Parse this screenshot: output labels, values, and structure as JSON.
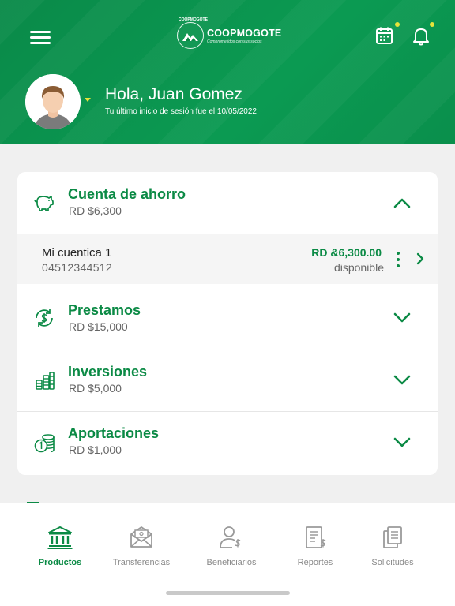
{
  "header": {
    "logo_name": "COOPMOGOTE",
    "logo_arc": "COOPMOGOTE",
    "logo_tagline": "Comprometidos con sus socios",
    "greeting": "Hola, Juan Gomez",
    "last_login": "Tu último inicio de sesión fue el 10/05/2022",
    "colors": {
      "primary": "#0b8a45",
      "notification_dot": "#e6e43a"
    }
  },
  "products": [
    {
      "title": "Cuenta de ahorro",
      "amount": "RD $6,300",
      "icon": "piggy-bank-icon",
      "expanded": true
    },
    {
      "title": "Prestamos",
      "amount": "RD $15,000",
      "icon": "loan-refresh-dollar-icon",
      "expanded": false
    },
    {
      "title": "Inversiones",
      "amount": "RD $5,000",
      "icon": "coins-stack-icon",
      "expanded": false
    },
    {
      "title": "Aportaciones",
      "amount": "RD $1,000",
      "icon": "coin-contribution-icon",
      "expanded": false
    }
  ],
  "account": {
    "name": "Mi cuentica 1",
    "number": "04512344512",
    "balance": "RD &6,300.00",
    "available_label": "disponible"
  },
  "tabs": [
    {
      "label": "Productos",
      "icon": "bank-building-icon",
      "active": true
    },
    {
      "label": "Transferencias",
      "icon": "transfer-envelope-icon",
      "active": false
    },
    {
      "label": "Beneficiarios",
      "icon": "user-dollar-icon",
      "active": false
    },
    {
      "label": "Reportes",
      "icon": "report-document-icon",
      "active": false
    },
    {
      "label": "Solicitudes",
      "icon": "requests-documents-icon",
      "active": false
    }
  ]
}
